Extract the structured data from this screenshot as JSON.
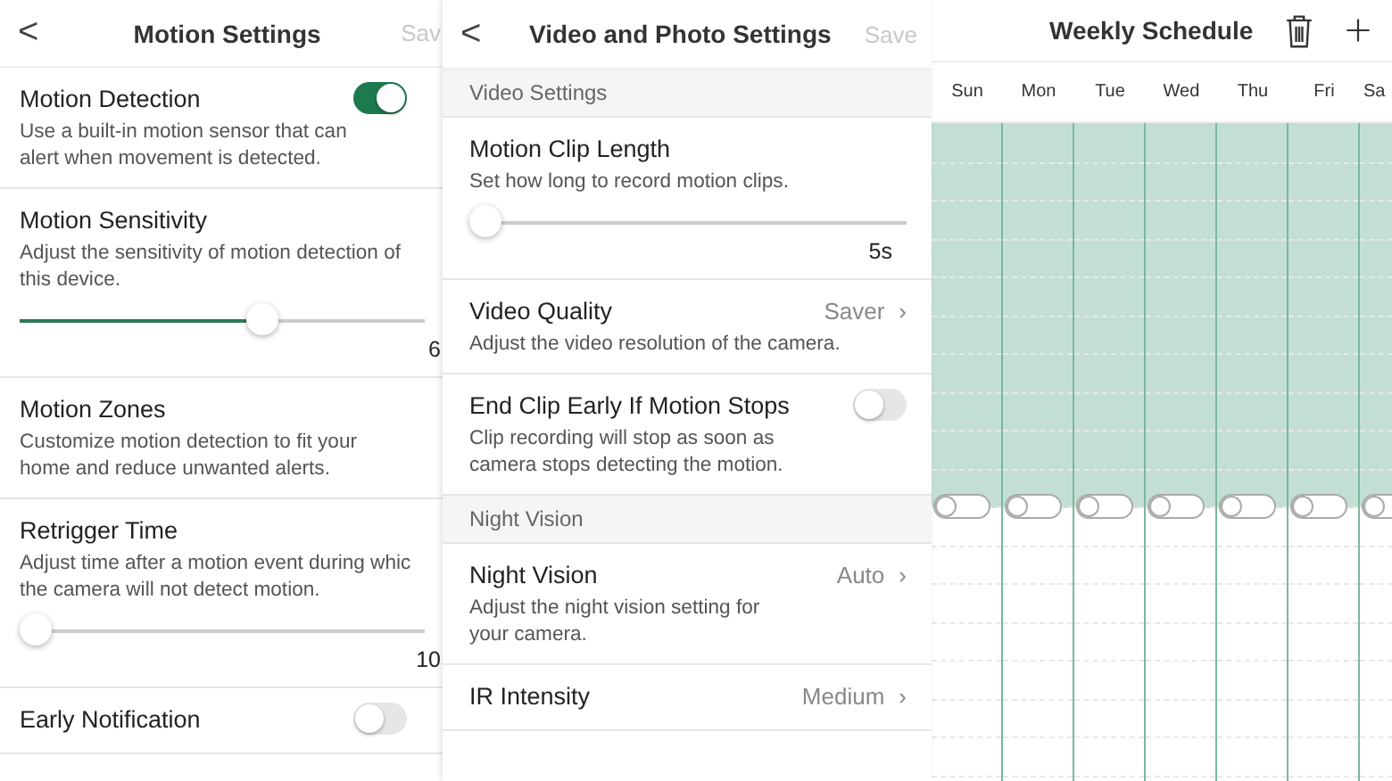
{
  "motion_settings": {
    "back": "<",
    "title": "Motion Settings",
    "save": "Sav",
    "rows": [
      {
        "kind": "toggle",
        "title": "Motion Detection",
        "description": "Use a built-in motion sensor that can\nalert when movement is detected.",
        "on": true
      },
      {
        "kind": "slider",
        "title": "Motion Sensitivity",
        "description": "Adjust the sensitivity of motion detection of\nthis device.",
        "level": 0.6,
        "reading": "6"
      },
      {
        "kind": "plain",
        "title": "Motion Zones",
        "description": "Customize motion detection to fit your\nhome and reduce unwanted alerts."
      },
      {
        "kind": "slider",
        "title": "Retrigger Time",
        "description": "Adjust time after a motion event during whic\nthe camera will not detect motion.",
        "level": 0,
        "reading": "10"
      },
      {
        "kind": "toggle",
        "title": "Early Notification",
        "on": false
      }
    ]
  },
  "video_settings": {
    "back": "<",
    "title": "Video and Photo Settings",
    "save": "Save",
    "sections": [
      {
        "header": "Video Settings",
        "rows": [
          {
            "kind": "slider",
            "title": "Motion Clip Length",
            "description": "Set how long to record motion clips.",
            "level": 0,
            "reading": "5s"
          },
          {
            "kind": "select",
            "title": "Video Quality",
            "description": "Adjust the video resolution of the camera.",
            "value": "Saver",
            "chevron": "›"
          },
          {
            "kind": "toggle",
            "title": "End Clip Early If Motion Stops",
            "description": "Clip recording will stop as soon as\ncamera stops detecting the motion.",
            "on": false
          }
        ]
      },
      {
        "header": "Night Vision",
        "rows": [
          {
            "kind": "select",
            "title": "Night Vision",
            "description": "Adjust the night vision setting for\nyour camera.",
            "value": "Auto",
            "chevron": "›"
          },
          {
            "kind": "select",
            "title": "IR Intensity",
            "value": "Medium",
            "chevron": "›"
          }
        ]
      }
    ]
  },
  "weekly_schedule": {
    "title": "Weekly Schedule",
    "days": [
      {
        "label": "Sun",
        "on": false
      },
      {
        "label": "Mon",
        "on": false
      },
      {
        "label": "Tue",
        "on": false
      },
      {
        "label": "Wed",
        "on": false
      },
      {
        "label": "Thu",
        "on": false
      },
      {
        "label": "Fri",
        "on": false
      },
      {
        "label": "Sa",
        "on": false
      }
    ]
  }
}
